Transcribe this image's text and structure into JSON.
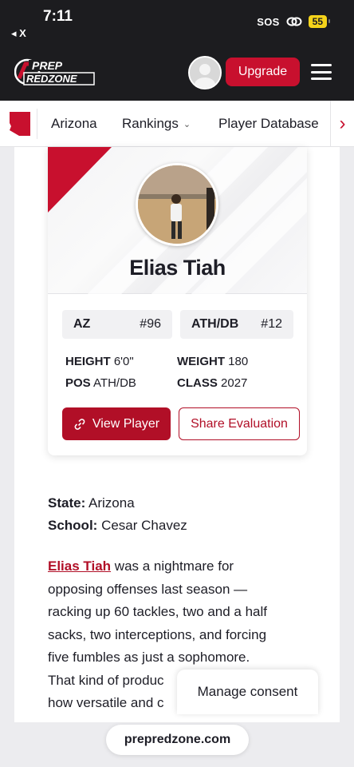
{
  "status_bar": {
    "time": "7:11",
    "back_label": "◂ X",
    "sos": "SOS",
    "battery": "55"
  },
  "header": {
    "logo_text": [
      "PREP",
      "REDZONE"
    ],
    "upgrade_label": "Upgrade",
    "brand_color": "#c8102e"
  },
  "nav": {
    "items": [
      {
        "label": "Arizona"
      },
      {
        "label": "Rankings"
      },
      {
        "label": "Player Database"
      }
    ]
  },
  "player_card": {
    "name": "Elias Tiah",
    "state_chip": {
      "label": "AZ",
      "number": "#96"
    },
    "position_chip": {
      "label": "ATH/DB",
      "number": "#12"
    },
    "stats": {
      "height_label": "HEIGHT",
      "height_value": "6'0\"",
      "weight_label": "WEIGHT",
      "weight_value": "180",
      "pos_label": "POS",
      "pos_value": "ATH/DB",
      "class_label": "CLASS",
      "class_value": "2027"
    },
    "view_button": "View Player",
    "share_button": "Share Evaluation"
  },
  "article": {
    "state_label": "State:",
    "state_value": "Arizona",
    "school_label": "School:",
    "school_value": "Cesar Chavez",
    "paragraph_link": "Elias Tiah",
    "paragraph_lines": [
      " was a nightmare for",
      "opposing offenses last season —",
      "racking up 60 tackles, two and a half",
      "sacks, two interceptions, and forcing",
      "five fumbles as just a sophomore.",
      "That kind of produc",
      "how versatile and c"
    ]
  },
  "consent_label": "Manage consent",
  "url": "prepredzone.com"
}
